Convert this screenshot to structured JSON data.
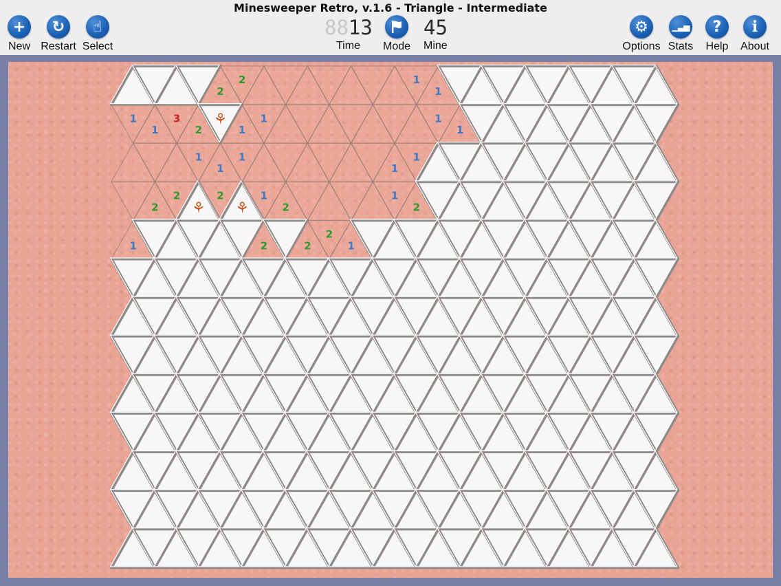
{
  "window": {
    "title": "Minesweeper Retro, v.1.6 - Triangle - Intermediate"
  },
  "toolbar": {
    "left": [
      {
        "id": "new",
        "label": "New",
        "icon": "plus-icon",
        "glyph": "+"
      },
      {
        "id": "restart",
        "label": "Restart",
        "icon": "restart-icon",
        "glyph": "↻"
      },
      {
        "id": "select",
        "label": "Select",
        "icon": "pointer-hand-icon",
        "glyph": "☝"
      }
    ],
    "right": [
      {
        "id": "options",
        "label": "Options",
        "icon": "gear-icon",
        "glyph": "⚙"
      },
      {
        "id": "stats",
        "label": "Stats",
        "icon": "bar-chart-icon",
        "glyph": "▁▃▅"
      },
      {
        "id": "help",
        "label": "Help",
        "icon": "question-icon",
        "glyph": "?"
      },
      {
        "id": "about",
        "label": "About",
        "icon": "info-icon",
        "glyph": "i"
      }
    ]
  },
  "status": {
    "time": {
      "label": "Time",
      "ghost": "88",
      "value": "13"
    },
    "mode": {
      "label": "Mode",
      "icon": "flag-icon"
    },
    "mine": {
      "label": "Mine",
      "value": "45"
    }
  },
  "colors": {
    "accent": "#1a5fb4",
    "board_background": "#e9a394",
    "frame": "#7880a8",
    "n1": "#3a78c9",
    "n2": "#2e9a2e",
    "n3": "#d42020",
    "leaf": "#c9541e"
  },
  "board": {
    "rows": 13,
    "cols": 25,
    "first_cell": "up",
    "grid": [
      ". . . . 2 2 o o o o o o o 1 1 . . . . . . . . . .",
      "1 1 3 2 F 1 1 o o o o o o o 1 1 . . . . . . . . .",
      "o o o 1 1 1 o o o o o o 1 1 . . . . . . . . . . .",
      "o 2 2 F 2 F 1 2 o o o o 1 2 . . . . . . . . . . .",
      "1 . . . . . 2 . 2 2 1 . . . . . . . . . . . . . .",
      ". . . . . . . . . . . . . . . . . . . . . . . . .",
      ". . . . . . . . . . . . . . . . . . . . . . . . .",
      ". . . . . . . . . . . . . . . . . . . . . . . . .",
      ". . . . . . . . . . . . . . . . . . . . . . . . .",
      ". . . . . . . . . . . . . . . . . . . . . . . . .",
      ". . . . . . . . . . . . . . . . . . . . . . . . .",
      ". . . . . . . . . . . . . . . . . . . . . . . . .",
      ". . . . . . . . . . . . . . . . . . . . . . . . ."
    ],
    "legend": {
      ".": "covered",
      "o": "open-empty",
      "F": "flag",
      "1-3": "open-number"
    }
  }
}
